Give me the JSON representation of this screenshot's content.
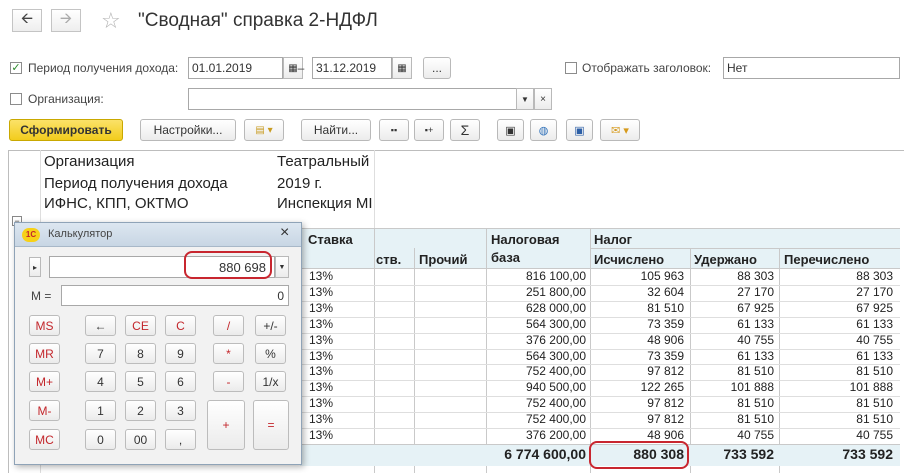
{
  "window": {
    "title": "\"Сводная\" справка 2-НДФЛ"
  },
  "form": {
    "period_label": "Период получения дохода:",
    "period_from": "01.01.2019",
    "period_dash": "–",
    "period_to": "31.12.2019",
    "ellipsis": "...",
    "show_header_label": "Отображать заголовок:",
    "show_header_value": "Нет",
    "org_label": "Организация:",
    "org_value": ""
  },
  "toolbar": {
    "generate": "Сформировать",
    "settings": "Настройки...",
    "find": "Найти...",
    "sigma": "Σ"
  },
  "report": {
    "info": [
      {
        "label": "Организация",
        "value": "Театральный"
      },
      {
        "label": "Период получения дохода",
        "value": "2019 г."
      },
      {
        "label": "ИФНС, КПП, ОКТМО",
        "value": "Инспекция МІ"
      }
    ],
    "headers": {
      "rate": "Ставка",
      "partial": "ств.",
      "other": "Прочий",
      "base_line1": "Налоговая",
      "base_line2": "база",
      "tax": "Налог",
      "calculated": "Исчислено",
      "withheld": "Удержано",
      "transferred": "Перечислено"
    },
    "rows": [
      {
        "rate": "13%",
        "base": "816 100,00",
        "calc": "105 963",
        "withheld": "88 303",
        "transferred": "88 303"
      },
      {
        "rate": "13%",
        "base": "251 800,00",
        "calc": "32 604",
        "withheld": "27 170",
        "transferred": "27 170"
      },
      {
        "rate": "13%",
        "base": "628 000,00",
        "calc": "81 510",
        "withheld": "67 925",
        "transferred": "67 925"
      },
      {
        "rate": "13%",
        "base": "564 300,00",
        "calc": "73 359",
        "withheld": "61 133",
        "transferred": "61 133"
      },
      {
        "rate": "13%",
        "base": "376 200,00",
        "calc": "48 906",
        "withheld": "40 755",
        "transferred": "40 755"
      },
      {
        "rate": "13%",
        "base": "564 300,00",
        "calc": "73 359",
        "withheld": "61 133",
        "transferred": "61 133"
      },
      {
        "rate": "13%",
        "base": "752 400,00",
        "calc": "97 812",
        "withheld": "81 510",
        "transferred": "81 510"
      },
      {
        "rate": "13%",
        "base": "940 500,00",
        "calc": "122 265",
        "withheld": "101 888",
        "transferred": "101 888"
      },
      {
        "rate": "13%",
        "base": "752 400,00",
        "calc": "97 812",
        "withheld": "81 510",
        "transferred": "81 510"
      },
      {
        "rate": "13%",
        "base": "752 400,00",
        "calc": "97 812",
        "withheld": "81 510",
        "transferred": "81 510"
      },
      {
        "rate": "13%",
        "base": "376 200,00",
        "calc": "48 906",
        "withheld": "40 755",
        "transferred": "40 755"
      }
    ],
    "totals": {
      "base": "6 774 600,00",
      "calc": "880 308",
      "withheld": "733 592",
      "transferred": "733 592"
    }
  },
  "calculator": {
    "title": "Калькулятор",
    "logo": "1С",
    "display": "880 698",
    "memory_label": "M =",
    "memory_value": "0",
    "buttons": {
      "ms": "MS",
      "back": "←",
      "ce": "CE",
      "c": "C",
      "div": "/",
      "pm": "+/-",
      "mr": "MR",
      "n7": "7",
      "n8": "8",
      "n9": "9",
      "mul": "*",
      "pct": "%",
      "mplus": "M+",
      "n4": "4",
      "n5": "5",
      "n6": "6",
      "minus": "-",
      "inv": "1/x",
      "mminus": "M-",
      "n1": "1",
      "n2": "2",
      "n3": "3",
      "plus": "+",
      "eq": "=",
      "mc": "MC",
      "n0": "0",
      "n00": "00",
      "dot": ","
    }
  },
  "colors": {
    "accent_yellow": "#f5d21f",
    "highlight_red": "#c8262f",
    "table_header": "#e8f3f7"
  }
}
